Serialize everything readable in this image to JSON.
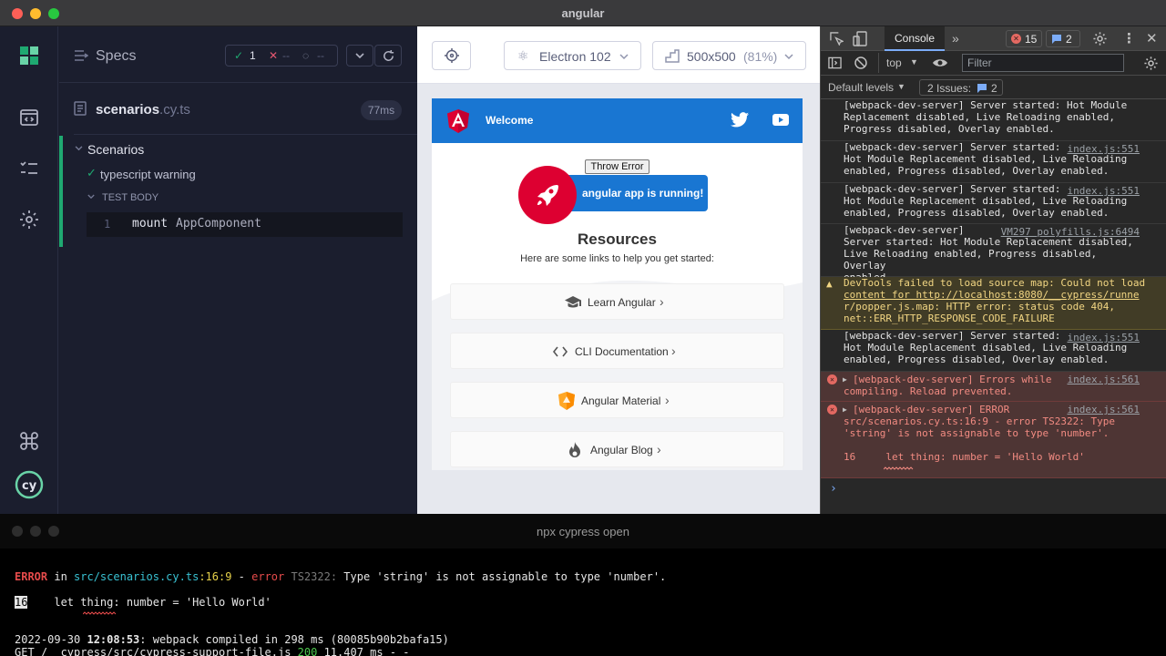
{
  "window": {
    "title": "angular"
  },
  "cypress": {
    "specs_label": "Specs",
    "stats": {
      "passed": "1",
      "failed": "--",
      "pending": "--"
    },
    "file": {
      "name": "scenarios",
      "ext": ".cy.ts",
      "duration": "77ms"
    },
    "suite": {
      "title": "Scenarios",
      "test_title": "typescript warning",
      "body_label": "TEST BODY",
      "command": {
        "index": "1",
        "name": "mount",
        "arg": "AppComponent"
      }
    }
  },
  "aut": {
    "browser": "Electron 102",
    "viewport": "500x500",
    "scale": "(81%)",
    "app": {
      "welcome": "Welcome",
      "throw_button": "Throw Error",
      "running": "angular app is running!",
      "resources_title": "Resources",
      "resources_sub": "Here are some links to help you get started:",
      "links": [
        {
          "label": "Learn Angular",
          "icon": "graduation-cap-icon"
        },
        {
          "label": "CLI Documentation",
          "icon": "code-brackets-icon"
        },
        {
          "label": "Angular Material",
          "icon": "material-shield-icon"
        },
        {
          "label": "Angular Blog",
          "icon": "flame-icon"
        }
      ]
    }
  },
  "devtools": {
    "tab": "Console",
    "error_count": "15",
    "message_count": "2",
    "context": "top",
    "filter_placeholder": "Filter",
    "levels": "Default levels",
    "issues_label": "2 Issues:",
    "issues_count": "2",
    "messages": [
      {
        "type": "log",
        "source": "",
        "lines": [
          "[webpack-dev-server] Server started: Hot Module",
          "Replacement disabled, Live Reloading enabled,",
          "Progress disabled, Overlay enabled."
        ]
      },
      {
        "type": "log",
        "source": "index.js:551",
        "lines": [
          "[webpack-dev-server] Server started:",
          "Hot Module Replacement disabled, Live Reloading",
          "enabled, Progress disabled, Overlay enabled."
        ]
      },
      {
        "type": "log",
        "source": "index.js:551",
        "lines": [
          "[webpack-dev-server] Server started:",
          "Hot Module Replacement disabled, Live Reloading",
          "enabled, Progress disabled, Overlay enabled."
        ]
      },
      {
        "type": "log",
        "source": "VM297 polyfills.js:6494",
        "lines": [
          "[webpack-dev-server]",
          "Server started: Hot Module Replacement disabled,",
          "Live Reloading enabled, Progress disabled, Overlay",
          "enabled."
        ]
      },
      {
        "type": "warn",
        "source": "",
        "lines": [
          "DevTools failed to load source map: Could not load",
          "content for http://localhost:8080/__cypress/runne",
          "r/popper.js.map: HTTP error: status code 404,",
          "net::ERR_HTTP_RESPONSE_CODE_FAILURE"
        ]
      },
      {
        "type": "log",
        "source": "index.js:551",
        "lines": [
          "[webpack-dev-server] Server started:",
          "Hot Module Replacement disabled, Live Reloading",
          "enabled, Progress disabled, Overlay enabled."
        ]
      },
      {
        "type": "error",
        "source": "index.js:561",
        "lines": [
          "[webpack-dev-server] Errors while",
          "compiling. Reload prevented."
        ]
      },
      {
        "type": "error",
        "source": "index.js:561",
        "lines": [
          "[webpack-dev-server] ERROR",
          "src/scenarios.cy.ts:16:9 - error TS2322: Type",
          "'string' is not assignable to type 'number'.",
          "",
          "16     let thing: number = 'Hello World'"
        ]
      }
    ]
  },
  "terminal": {
    "title": "npx cypress open",
    "error_line": {
      "prefix": "ERROR",
      "in": " in ",
      "file": "src/scenarios.cy.ts",
      "pos": ":16:9",
      "dash": " - ",
      "error": "error",
      "code": " TS2322:",
      "msg": " Type 'string' is not assignable to type 'number'."
    },
    "code_line": {
      "num": "16",
      "code": "    let thing: number = 'Hello World'"
    },
    "compiled_line": {
      "date": "2022-09-30 ",
      "time": "12:08:53",
      "rest": ": webpack compiled in 298 ms (80085b90b2bafa15)"
    },
    "get_line": {
      "text": "GET /__cypress/src/cypress-support-file.js ",
      "status": "200",
      "rest": " 11.407 ms - -"
    }
  },
  "colors": {
    "cypress_bg": "#1b1e2e",
    "pass_green": "#1fa971",
    "fail_red": "#e45770",
    "angular_red": "#dd0031",
    "material_blue": "#1976d2",
    "devtools_bg": "#282828",
    "error_bg": "#4e3534",
    "warn_bg": "#413c26"
  }
}
